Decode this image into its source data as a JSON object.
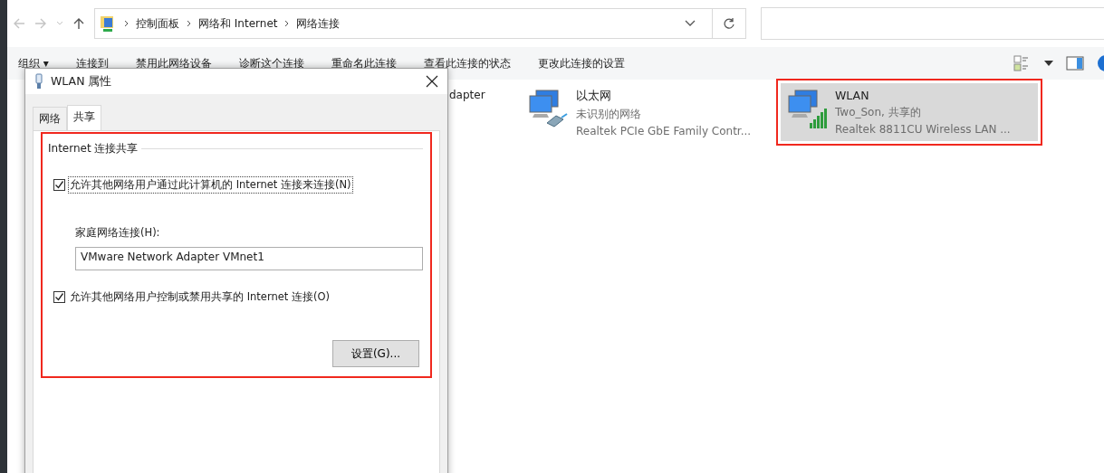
{
  "breadcrumb": [
    "控制面板",
    "网络和 Internet",
    "网络连接"
  ],
  "toolbar": [
    "组织 ▾",
    "连接到",
    "禁用此网络设备",
    "诊断这个连接",
    "重命名此连接",
    "查看此连接的状态",
    "更改此连接的设置"
  ],
  "hidden_item_text": "dapter",
  "connections": [
    {
      "name": "以太网",
      "status": "未识别的网络",
      "adapter": "Realtek PCIe GbE Family Contr...",
      "kind": "ethernet",
      "selected": false,
      "highlighted": false
    },
    {
      "name": "WLAN",
      "status": "Two_Son, 共享的",
      "adapter": "Realtek 8811CU Wireless LAN ...",
      "kind": "wifi",
      "selected": true,
      "highlighted": true
    }
  ],
  "dialog": {
    "title": "WLAN 属性",
    "tabs": [
      {
        "label": "网络",
        "selected": false
      },
      {
        "label": "共享",
        "selected": true
      }
    ],
    "group_title": "Internet 连接共享",
    "allow_sharing": {
      "label": "允许其他网络用户通过此计算机的 Internet 连接来连接(N)",
      "checked": true,
      "focused": true
    },
    "home_label": "家庭网络连接(H):",
    "home_value": "VMware Network Adapter VMnet1",
    "allow_control": {
      "label": "允许其他网络用户控制或禁用共享的 Internet 连接(O)",
      "checked": true,
      "focused": false
    },
    "settings_button": "设置(G)...",
    "highlighted": true
  }
}
